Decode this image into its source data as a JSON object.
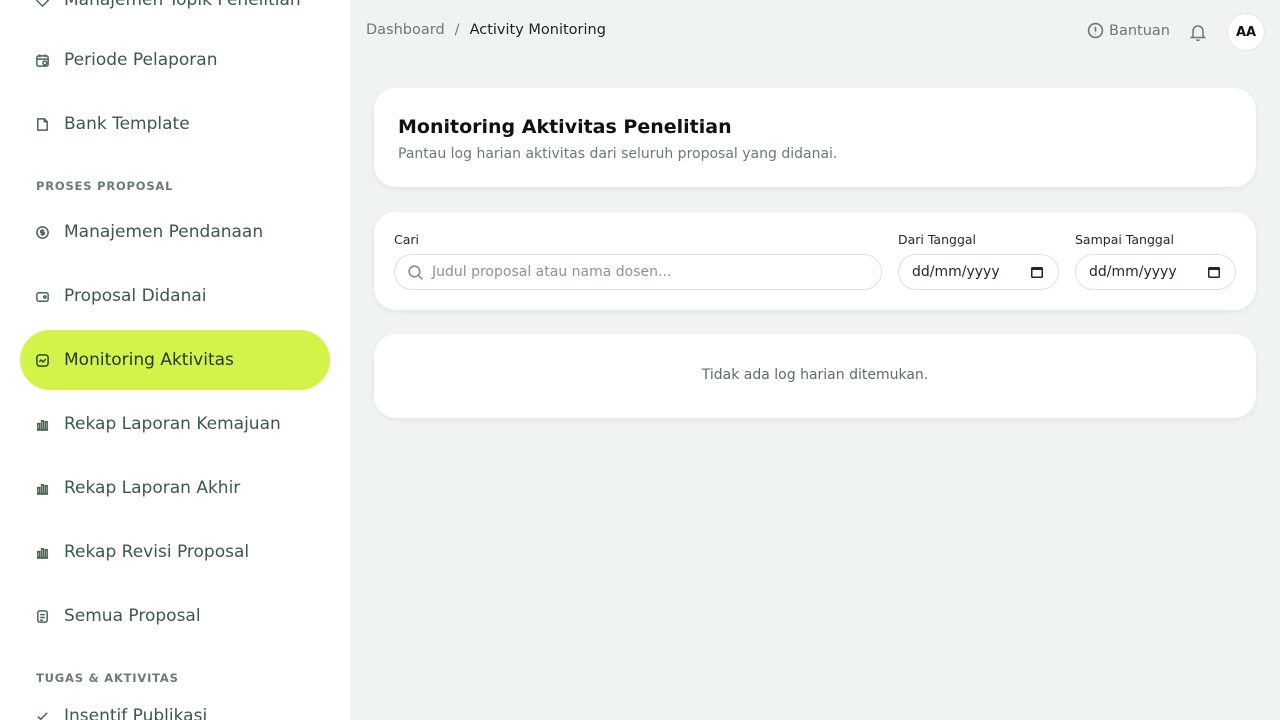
{
  "sidebar": {
    "items": [
      {
        "label": "Manajemen Topik Penelitian",
        "icon": "tag-icon"
      },
      {
        "label": "Periode Pelaporan",
        "icon": "calendar-icon"
      },
      {
        "label": "Bank Template",
        "icon": "file-icon"
      },
      {
        "label": "Manajemen Pendanaan",
        "icon": "dollar-icon"
      },
      {
        "label": "Proposal Didanai",
        "icon": "wallet-icon"
      },
      {
        "label": "Monitoring Aktivitas",
        "icon": "activity-icon",
        "active": true
      },
      {
        "label": "Rekap Laporan Kemajuan",
        "icon": "bar-chart-icon"
      },
      {
        "label": "Rekap Laporan Akhir",
        "icon": "bar-chart-icon"
      },
      {
        "label": "Rekap Revisi Proposal",
        "icon": "bar-chart-icon"
      },
      {
        "label": "Semua Proposal",
        "icon": "document-icon"
      },
      {
        "label": "Insentif Publikasi",
        "icon": "check-icon"
      }
    ],
    "sections": {
      "proses": "PROSES PROPOSAL",
      "tugas": "TUGAS & AKTIVITAS"
    }
  },
  "header": {
    "breadcrumb": [
      "Dashboard",
      "Activity Monitoring"
    ],
    "separator": "/",
    "help": "Bantuan",
    "avatar": "AA"
  },
  "main": {
    "title": "Monitoring Aktivitas Penelitian",
    "subtitle": "Pantau log harian aktivitas dari seluruh proposal yang didanai.",
    "filters": {
      "search_label": "Cari",
      "search_placeholder": "Judul proposal atau nama dosen...",
      "from_label": "Dari Tanggal",
      "from_value": "dd/mm/yyyy",
      "to_label": "Sampai Tanggal",
      "to_value": "dd/mm/yyyy"
    },
    "empty_message": "Tidak ada log harian ditemukan."
  },
  "colors": {
    "accent": "#d4f34a",
    "background": "#eff3f1",
    "nav_text": "#3a5a48"
  }
}
